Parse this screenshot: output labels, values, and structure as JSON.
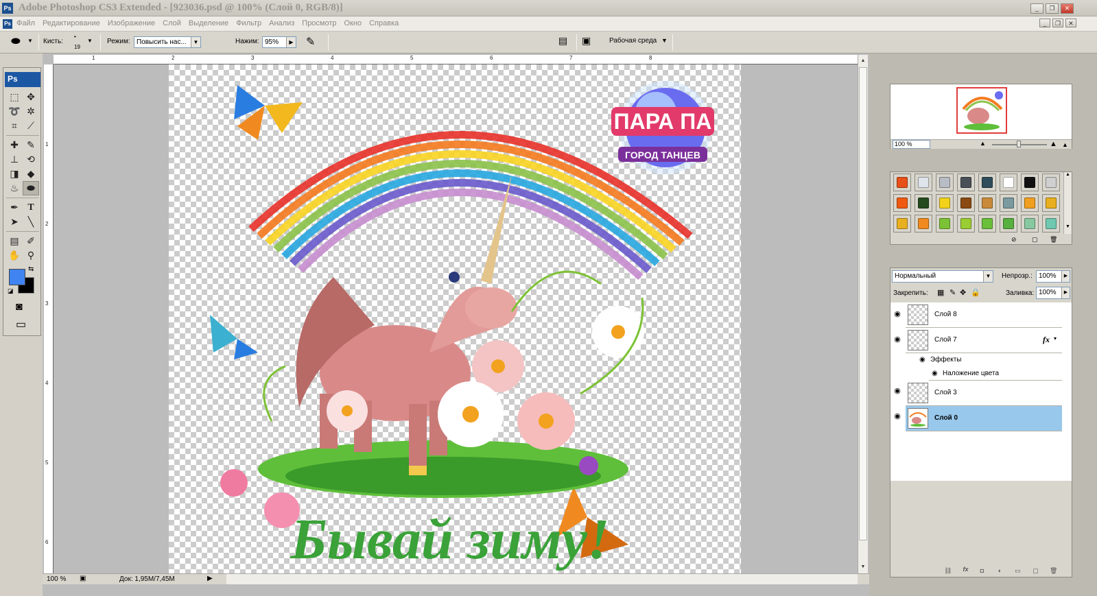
{
  "window": {
    "title": "Adobe Photoshop CS3 Extended - [923036.psd @ 100% (Слой 0, RGB/8)]",
    "app_icon": "Ps"
  },
  "menu": [
    "Файл",
    "Редактирование",
    "Изображение",
    "Слой",
    "Выделение",
    "Фильтр",
    "Анализ",
    "Просмотр",
    "Окно",
    "Справка"
  ],
  "options": {
    "brush_label": "Кисть:",
    "brush_size": "19",
    "mode_label": "Режим:",
    "mode_value": "Повысить нас...",
    "pressure_label": "Нажим:",
    "pressure_value": "95%",
    "workspace_label": "Рабочая среда"
  },
  "toolbox": {
    "logo": "Ps",
    "fg_color": "#3f84f0",
    "bg_color": "#000000"
  },
  "rulers": {
    "top": [
      "1",
      "2",
      "3",
      "4",
      "5",
      "6",
      "7",
      "8"
    ],
    "left": [
      "1",
      "2",
      "3",
      "4",
      "5",
      "6"
    ]
  },
  "status": {
    "zoom": "100 %",
    "doc_size": "Док: 1,95M/7,45M"
  },
  "navigator": {
    "zoom": "100 %"
  },
  "styles": {
    "swatches": [
      "#e8501a",
      "#dfe3ea",
      "#b8bcc4",
      "#4a5058",
      "#2f4d5a",
      "#ffffff",
      "#111111",
      "#cfcfcf",
      "#f05a10",
      "#244a1e",
      "#f2d21a",
      "#8b4a12",
      "#c98a3a",
      "#7a9aa0",
      "#f0a020",
      "#e8b020",
      "#e8b020",
      "#f08a20",
      "#7cc234",
      "#9acd32",
      "#6bbf3a",
      "#58b040",
      "#88c8a0",
      "#70c8b0"
    ]
  },
  "layers": {
    "blend_mode": "Нормальный",
    "opacity_label": "Непрозр.:",
    "opacity_value": "100%",
    "lock_label": "Закрепить:",
    "fill_label": "Заливка:",
    "fill_value": "100%",
    "items": [
      {
        "name": "Слой 8",
        "selected": false,
        "fx": ""
      },
      {
        "name": "Слой 7",
        "selected": false,
        "fx": "fx"
      },
      {
        "name": "Слой 3",
        "selected": false,
        "fx": ""
      },
      {
        "name": "Слой 0",
        "selected": true,
        "fx": ""
      }
    ],
    "effects_label": "Эффекты",
    "effect_item": "Наложение цвета"
  },
  "artwork": {
    "logo_title": "ПАРА ПА",
    "logo_subtitle": "ГОРОД ТАНЦЕВ",
    "caption": "Бывай зиму!"
  }
}
